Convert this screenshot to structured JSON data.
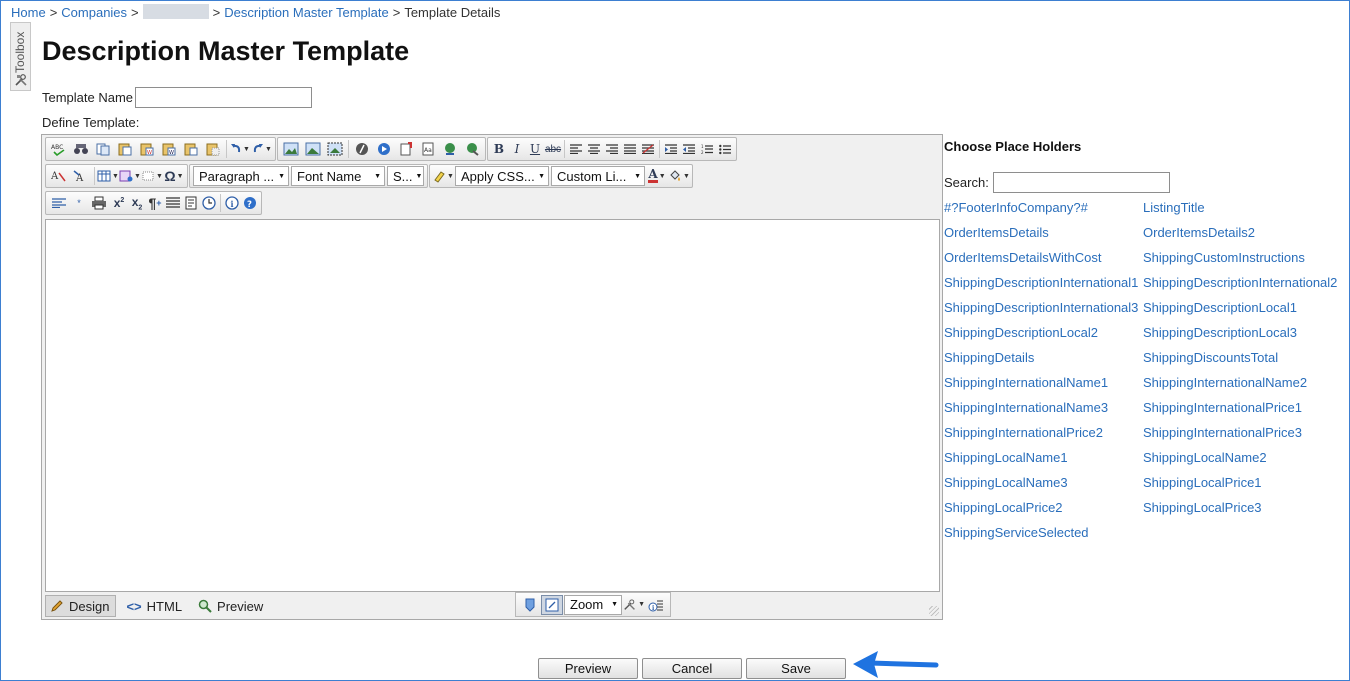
{
  "breadcrumb": {
    "home": "Home",
    "companies": "Companies",
    "master": "Description Master Template",
    "current": "Template Details",
    "sep": ">"
  },
  "toolbox": {
    "label": "Toolbox"
  },
  "page": {
    "title": "Description Master Template",
    "template_name_label": "Template Name",
    "template_name_value": "",
    "define_label": "Define Template:"
  },
  "editor": {
    "format_block": "Paragraph ...",
    "font_name": "Font Name",
    "font_size": "S...",
    "apply_css": "Apply CSS...",
    "custom_links": "Custom Li...",
    "modes": {
      "design": "Design",
      "html": "HTML",
      "preview": "Preview"
    },
    "zoom": "Zoom"
  },
  "placeholders": {
    "title": "Choose Place Holders",
    "search_label": "Search:",
    "search_value": "",
    "items": [
      "#?FooterInfoCompany?#",
      "ListingTitle",
      "OrderItemsDetails",
      "OrderItemsDetails2",
      "OrderItemsDetailsWithCost",
      "ShippingCustomInstructions",
      "ShippingDescriptionInternational1",
      "ShippingDescriptionInternational2",
      "ShippingDescriptionInternational3",
      "ShippingDescriptionLocal1",
      "ShippingDescriptionLocal2",
      "ShippingDescriptionLocal3",
      "ShippingDetails",
      "ShippingDiscountsTotal",
      "ShippingInternationalName1",
      "ShippingInternationalName2",
      "ShippingInternationalName3",
      "ShippingInternationalPrice1",
      "ShippingInternationalPrice2",
      "ShippingInternationalPrice3",
      "ShippingLocalName1",
      "ShippingLocalName2",
      "ShippingLocalName3",
      "ShippingLocalPrice1",
      "ShippingLocalPrice2",
      "ShippingLocalPrice3",
      "ShippingServiceSelected"
    ]
  },
  "actions": {
    "preview": "Preview",
    "cancel": "Cancel",
    "save": "Save"
  },
  "colors": {
    "link": "#2a6ebb",
    "frame": "#3d7fd1",
    "pointer_arrow": "#1f73e0"
  }
}
